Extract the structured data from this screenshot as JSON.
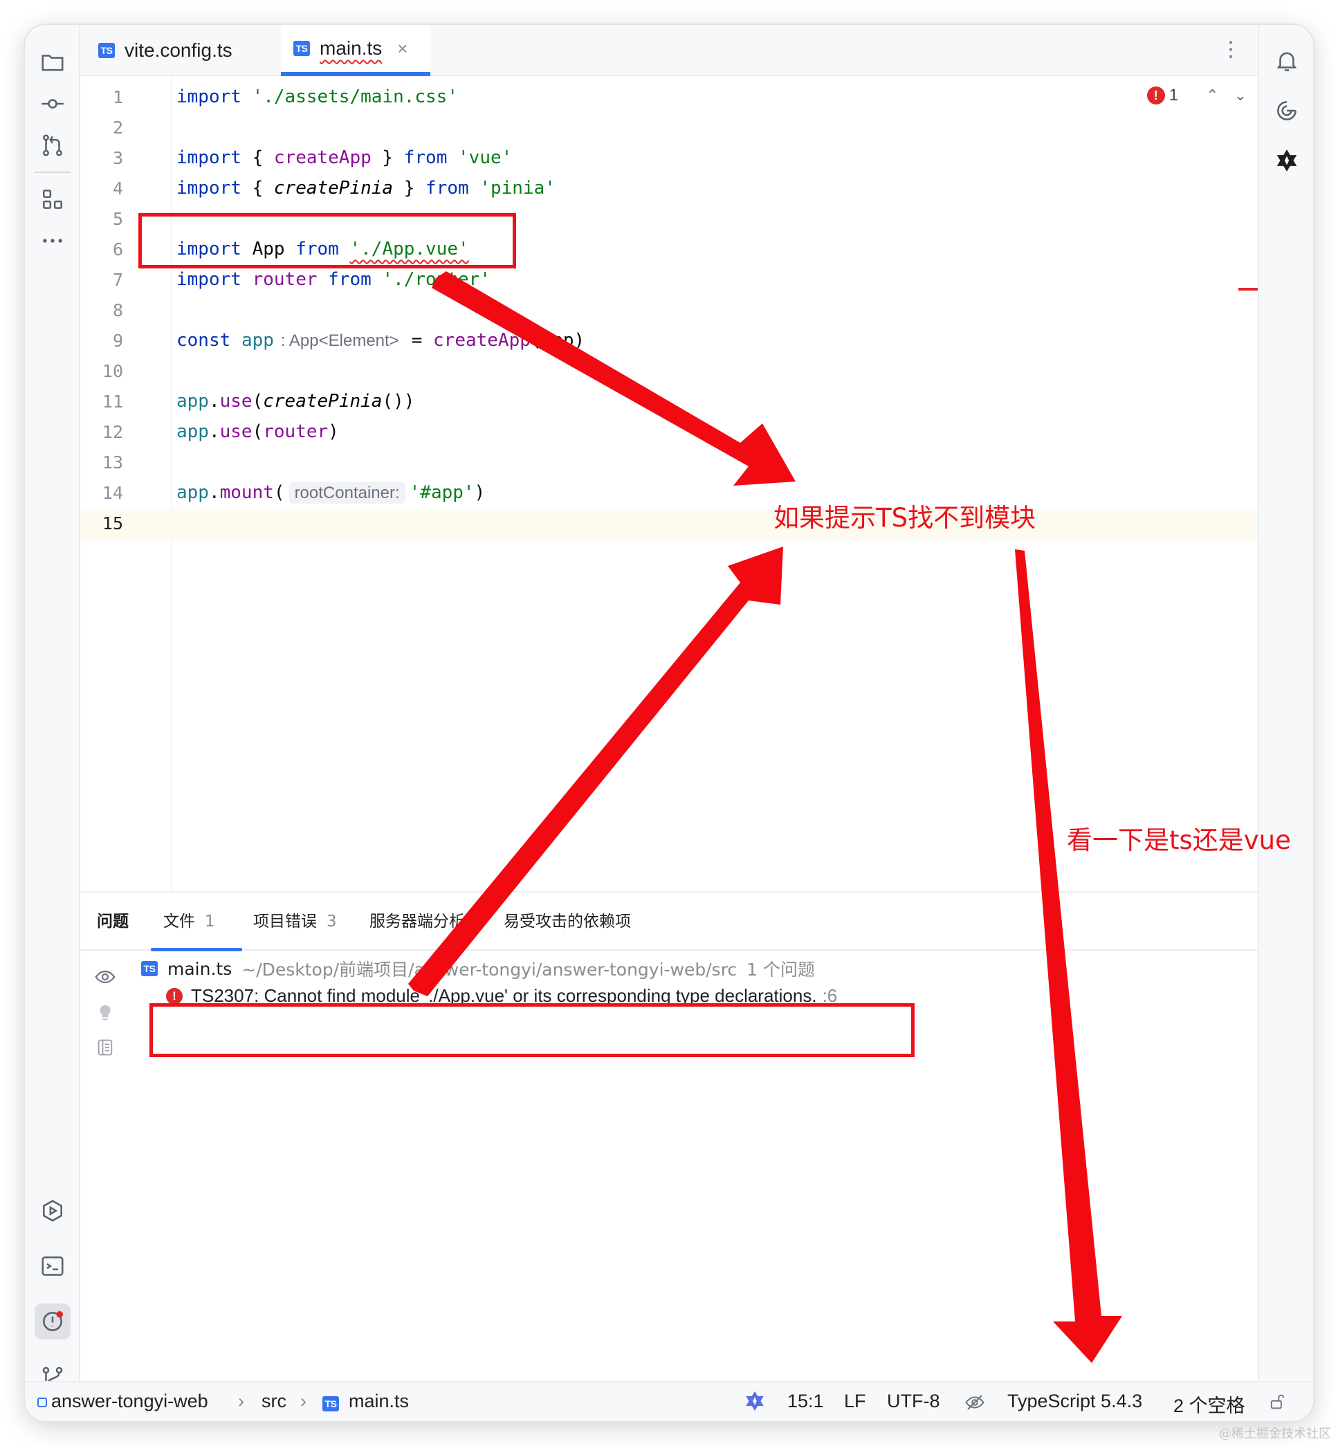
{
  "tabs": [
    {
      "label": "vite.config.ts",
      "badge": "TS"
    },
    {
      "label": "main.ts",
      "badge": "TS",
      "close": "×"
    }
  ],
  "tabbar": {
    "more": "⋮"
  },
  "editor": {
    "lines": [
      {
        "n": "1"
      },
      {
        "n": "2"
      },
      {
        "n": "3"
      },
      {
        "n": "4"
      },
      {
        "n": "5"
      },
      {
        "n": "6"
      },
      {
        "n": "7"
      },
      {
        "n": "8"
      },
      {
        "n": "9"
      },
      {
        "n": "10"
      },
      {
        "n": "11"
      },
      {
        "n": "12"
      },
      {
        "n": "13"
      },
      {
        "n": "14"
      },
      {
        "n": "15"
      }
    ],
    "code": {
      "l1_kw": "import",
      "l1_str": "'./assets/main.css'",
      "l3_kw": "import",
      "l3_o": "{ ",
      "l3_fn": "createApp",
      "l3_c": " }",
      "l3_from": "from",
      "l3_str": "'vue'",
      "l4_kw": "import",
      "l4_o": "{ ",
      "l4_fn": "createPinia",
      "l4_c": " }",
      "l4_from": "from",
      "l4_str": "'pinia'",
      "l6_kw": "import",
      "l6_id": "App",
      "l6_from": "from",
      "l6_str": "'./App.vue'",
      "l7_kw": "import",
      "l7_id": "router",
      "l7_from": "from",
      "l7_str": "'./router'",
      "l9_kw": "const",
      "l9_var": "app",
      "l9_hint": ": App<Element>",
      "l9_eq": "=",
      "l9_fn": "createApp",
      "l9_arg": "(App)",
      "l11_var": "app",
      "l11_dot": ".",
      "l11_fn": "use",
      "l11_o": "(",
      "l11_arg": "createPinia",
      "l11_c": "())",
      "l12_var": "app",
      "l12_dot": ".",
      "l12_fn": "use",
      "l12_o": "(",
      "l12_arg": "router",
      "l12_c": ")",
      "l14_var": "app",
      "l14_dot": ".",
      "l14_fn": "mount",
      "l14_o": "(",
      "l14_hint": "rootContainer:",
      "l14_str": "'#app'",
      "l14_c": ")"
    },
    "inspection": {
      "icon": "!",
      "count": "1",
      "up": "⌃",
      "down": "⌄"
    }
  },
  "problems": {
    "tabs": [
      {
        "label": "问题"
      },
      {
        "label": "文件",
        "count": "1"
      },
      {
        "label": "项目错误",
        "count": "3"
      },
      {
        "label": "服务器端分析"
      },
      {
        "label": "易受攻击的依赖项"
      }
    ],
    "file": {
      "badge": "TS",
      "name": "main.ts",
      "path": "~/Desktop/前端项目/answer-tongyi/answer-tongyi-web/src",
      "count": "1 个问题"
    },
    "error": {
      "icon": "!",
      "message": "TS2307: Cannot find module './App.vue' or its corresponding type declarations.",
      "line": ":6"
    }
  },
  "statusbar": {
    "project": "answer-tongyi-web",
    "sep": "›",
    "folder": "src",
    "file_badge": "TS",
    "file": "main.ts",
    "position": "15:1",
    "line_ending": "LF",
    "encoding": "UTF-8",
    "language": "TypeScript 5.4.3",
    "indent": "2 个空格"
  },
  "annotations": {
    "note1": "如果提示TS找不到模块",
    "note2": "看一下是ts还是vue"
  },
  "watermark": "@稀土掘金技术社区",
  "colors": {
    "accent": "#3574f0",
    "error": "#e0282b",
    "annotation": "#e8131b"
  }
}
